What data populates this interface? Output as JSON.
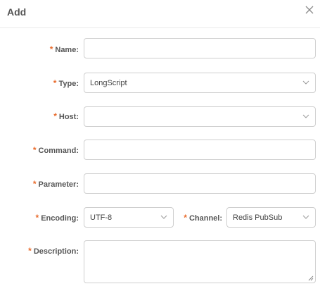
{
  "dialog": {
    "title": "Add",
    "close_icon": "close-icon"
  },
  "form": {
    "required_mark": "*",
    "name": {
      "label": "Name:",
      "value": ""
    },
    "type": {
      "label": "Type:",
      "value": "LongScript"
    },
    "host": {
      "label": "Host:",
      "value": ""
    },
    "command": {
      "label": "Command:",
      "value": ""
    },
    "parameter": {
      "label": "Parameter:",
      "value": ""
    },
    "encoding": {
      "label": "Encoding:",
      "value": "UTF-8"
    },
    "channel": {
      "label": "Channel:",
      "value": "Redis PubSub"
    },
    "description": {
      "label": "Description:",
      "value": ""
    }
  },
  "colors": {
    "required": "#e96c2d",
    "border": "#cfcfcf"
  }
}
